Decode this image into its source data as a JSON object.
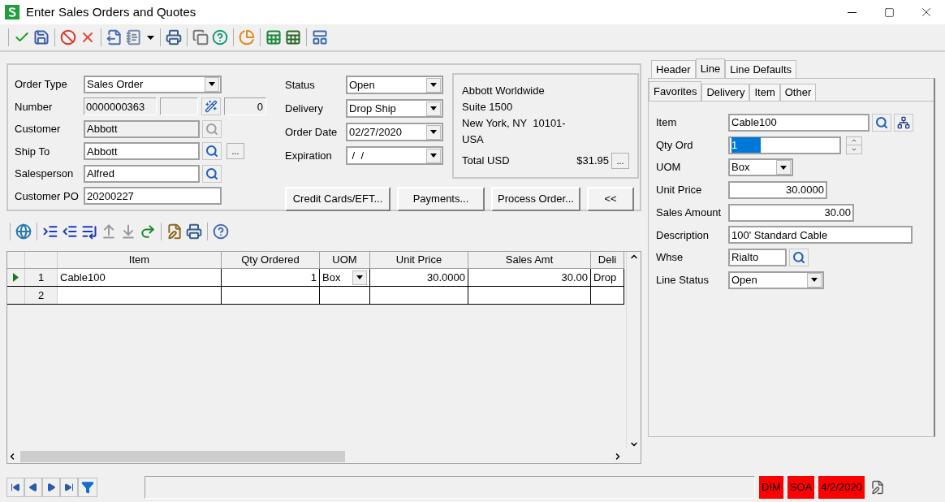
{
  "window": {
    "title": "Enter Sales Orders and Quotes"
  },
  "header": {
    "left_fields": [
      {
        "label": "Order Type",
        "value": "Sales Order",
        "kind": "combo",
        "disabled": false
      },
      {
        "label": "Number",
        "value": "0000000363",
        "kind": "number",
        "disabled": true,
        "counter": "0"
      },
      {
        "label": "Customer",
        "value": "Abbott",
        "kind": "lookup",
        "disabled": true
      },
      {
        "label": "Ship To",
        "value": "Abbott",
        "kind": "lookup",
        "disabled": false,
        "more": "..."
      },
      {
        "label": "Salesperson",
        "value": "Alfred",
        "kind": "lookup",
        "disabled": false
      },
      {
        "label": "Customer PO",
        "value": "20200227",
        "kind": "text",
        "disabled": false
      }
    ],
    "right_fields": [
      {
        "label": "Status",
        "value": "Open",
        "kind": "combo"
      },
      {
        "label": "Delivery",
        "value": "Drop Ship",
        "kind": "combo"
      },
      {
        "label": "Order Date",
        "value": "02/27/2020",
        "kind": "combo"
      },
      {
        "label": "Expiration",
        "value": " /  /",
        "kind": "combo"
      }
    ],
    "address": [
      "Abbott Worldwide",
      "Suite 1500",
      "New York, NY  10101-",
      "USA"
    ],
    "total_label": "Total USD",
    "total_value": "$31.95",
    "total_button": "...",
    "buttons": [
      "Credit Cards/EFT...",
      "Payments...",
      "Process Order...",
      "<<"
    ]
  },
  "grid": {
    "columns": [
      {
        "label": "Item",
        "kind": "text"
      },
      {
        "label": "Qty Ordered",
        "kind": "number"
      },
      {
        "label": "UOM",
        "kind": "combo"
      },
      {
        "label": "Unit Price",
        "kind": "number"
      },
      {
        "label": "Sales Amt",
        "kind": "number"
      },
      {
        "label": "Deli",
        "kind": "text"
      }
    ],
    "rows": [
      {
        "number": "1",
        "current": true,
        "cells": [
          "Cable100",
          "1",
          "Box",
          "30.0000",
          "30.00",
          "Drop"
        ]
      },
      {
        "number": "2",
        "current": false
      }
    ]
  },
  "tabs": [
    {
      "label": "Header",
      "selected": false
    },
    {
      "label": "Line",
      "selected": true
    },
    {
      "label": "Line Defaults",
      "selected": false
    }
  ],
  "subtabs": [
    {
      "label": "Favorites",
      "selected": true
    },
    {
      "label": "Delivery",
      "selected": false
    },
    {
      "label": "Item",
      "selected": false
    },
    {
      "label": "Other",
      "selected": false
    }
  ],
  "line_fields": [
    {
      "label": "Item",
      "value": "Cable100",
      "kind": "item"
    },
    {
      "label": "Qty Ord",
      "value": "1",
      "kind": "spin",
      "text_selected": true
    },
    {
      "label": "UOM",
      "value": "Box",
      "kind": "combo_short"
    },
    {
      "label": "Unit Price",
      "value": "30.0000",
      "kind": "number"
    },
    {
      "label": "Sales Amount",
      "value": "30.00",
      "kind": "number_wide"
    },
    {
      "label": "Description",
      "value": "100' Standard Cable",
      "kind": "text"
    },
    {
      "label": "Whse",
      "value": "Rialto",
      "kind": "lookup"
    },
    {
      "label": "Line Status",
      "value": "Open",
      "kind": "combo"
    }
  ],
  "status_bar": {
    "indicators": [
      "DIM",
      "SOA"
    ],
    "date": "4/2/2020"
  }
}
